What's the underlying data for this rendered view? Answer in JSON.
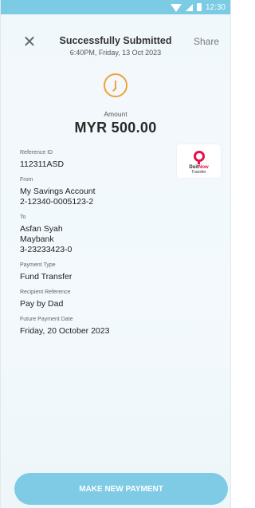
{
  "status_bar": {
    "time": "12:30",
    "icons": [
      "wifi-icon",
      "signal-icon",
      "battery-icon"
    ],
    "color": "#7bcbe5"
  },
  "header": {
    "close_icon": "close-icon",
    "title": "Successfully Submitted",
    "subtitle": "6:40PM, Friday, 13 Oct 2023",
    "share_label": "Share"
  },
  "status_icon": {
    "name": "clock-icon",
    "color": "#f0a23a"
  },
  "amount": {
    "label": "Amount",
    "value": "MYR 500.00"
  },
  "logo": {
    "name": "duitnow-logo-icon",
    "text_a": "Duit",
    "text_b": "Now",
    "sub": "Transfer",
    "color": "#e4124a"
  },
  "details": {
    "reference_id": {
      "label": "Reference ID",
      "value": "112311ASD"
    },
    "from": {
      "label": "From",
      "line1": "My Savings Account",
      "line2": "2-12340-0005123-2"
    },
    "to": {
      "label": "To",
      "line1": "Asfan Syah",
      "line2": "Maybank",
      "line3": "3-23233423-0"
    },
    "payment_type": {
      "label": "Payment Type",
      "value": "Fund Transfer"
    },
    "recipient_reference": {
      "label": "Recipient Reference",
      "value": "Pay by Dad"
    },
    "future_payment_date": {
      "label": "Future Payment Date",
      "value": "Friday, 20 October 2023"
    }
  },
  "cta": {
    "label": "MAKE NEW PAYMENT",
    "color": "#7fcbe5"
  }
}
